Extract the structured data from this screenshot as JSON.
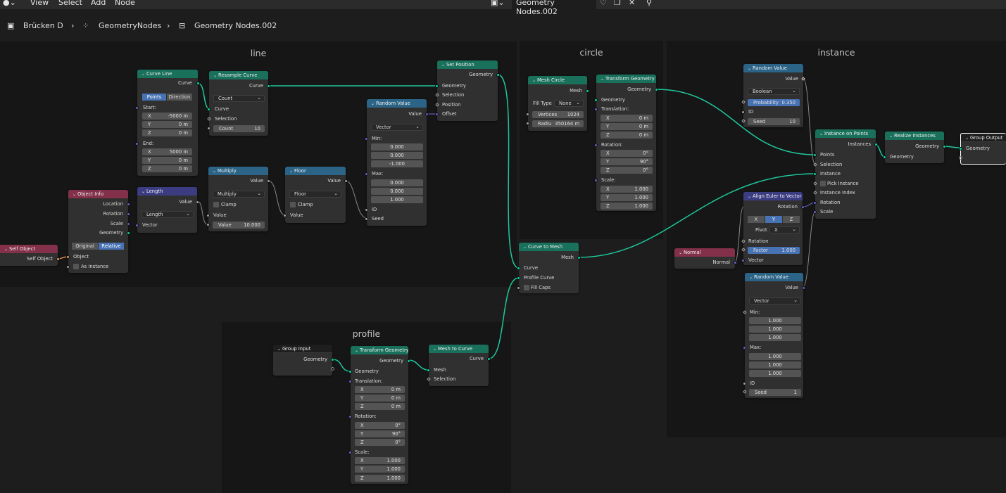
{
  "menu": {
    "view": "View",
    "select": "Select",
    "add": "Add",
    "node": "Node",
    "tree_name": "Geometry Nodes.002"
  },
  "breadcrumb": {
    "object": "Brücken D",
    "modifier": "GeometryNodes",
    "tree": "Geometry Nodes.002"
  },
  "frames": {
    "line": "line",
    "circle": "circle",
    "instance": "instance",
    "profile": "profile"
  },
  "curve_line": {
    "title": "Curve Line",
    "out_curve": "Curve",
    "mode_points": "Points",
    "mode_direction": "Direction",
    "start": "Start:",
    "end": "End:",
    "sx": "-5000 m",
    "sy": "0 m",
    "sz": "0 m",
    "ex": "5000 m",
    "ey": "0 m",
    "ez": "0 m",
    "x": "X",
    "y": "Y",
    "z": "Z"
  },
  "resample": {
    "title": "Resample Curve",
    "out_curve": "Curve",
    "mode": "Count",
    "in_curve": "Curve",
    "selection": "Selection",
    "count_label": "Count",
    "count": "10"
  },
  "set_position": {
    "title": "Set Position",
    "out_geometry": "Geometry",
    "geometry": "Geometry",
    "selection": "Selection",
    "position": "Position",
    "offset": "Offset"
  },
  "random_vec": {
    "title": "Random Value",
    "out_value": "Value",
    "type": "Vector",
    "min": "Min:",
    "max": "Max:",
    "min_vals": [
      "0.000",
      "0.000",
      "-1.000"
    ],
    "max_vals": [
      "0.000",
      "0.000",
      "1.000"
    ],
    "id": "ID",
    "seed": "Seed"
  },
  "multiply": {
    "title": "Multiply",
    "out_value": "Value",
    "op": "Multiply",
    "clamp": "Clamp",
    "value": "Value",
    "value_label": "Value",
    "value_num": "10.000"
  },
  "floor": {
    "title": "Floor",
    "out_value": "Value",
    "op": "Floor",
    "clamp": "Clamp",
    "value": "Value"
  },
  "length": {
    "title": "Length",
    "out_value": "Value",
    "op": "Length",
    "vector": "Vector"
  },
  "object_info": {
    "title": "Object Info",
    "location": "Location",
    "rotation": "Rotation",
    "scale": "Scale",
    "geometry": "Geometry",
    "original": "Original",
    "relative": "Relative",
    "object": "Object",
    "as_instance": "As Instance"
  },
  "self_object": {
    "title": "Self Object",
    "out": "Self Object"
  },
  "mesh_circle": {
    "title": "Mesh Circle",
    "out_mesh": "Mesh",
    "fill_type": "Fill Type",
    "fill_value": "None",
    "vertices_label": "Vertices",
    "vertices": "1024",
    "radius_label": "Radiu",
    "radius": "350164 m"
  },
  "transform_circle": {
    "title": "Transform Geometry",
    "out_geometry": "Geometry",
    "geometry": "Geometry",
    "translation": "Translation:",
    "rotation": "Rotation:",
    "scale": "Scale:",
    "t": [
      "0 m",
      "0 m",
      "0 m"
    ],
    "r": [
      "0°",
      "90°",
      "0°"
    ],
    "s": [
      "1.000",
      "1.000",
      "1.000"
    ]
  },
  "curve_to_mesh": {
    "title": "Curve to Mesh",
    "out_mesh": "Mesh",
    "curve": "Curve",
    "profile": "Profile Curve",
    "fill_caps": "Fill Caps"
  },
  "group_input": {
    "title": "Group Input",
    "geometry": "Geometry"
  },
  "transform_profile": {
    "title": "Transform Geometry",
    "out_geometry": "Geometry",
    "geometry": "Geometry",
    "translation": "Translation:",
    "rotation": "Rotation:",
    "scale": "Scale:",
    "t": [
      "0 m",
      "0 m",
      "0 m"
    ],
    "r": [
      "0°",
      "90°",
      "0°"
    ],
    "s": [
      "1.000",
      "1.000",
      "1.000"
    ]
  },
  "mesh_to_curve": {
    "title": "Mesh to Curve",
    "out_curve": "Curve",
    "mesh": "Mesh",
    "selection": "Selection"
  },
  "random_bool": {
    "title": "Random Value",
    "out_value": "Value",
    "type": "Boolean",
    "prob_label": "Probability",
    "prob": "0.350",
    "id": "ID",
    "seed_label": "Seed",
    "seed": "10"
  },
  "instance_on_points": {
    "title": "Instance on Points",
    "out_instances": "Instances",
    "points": "Points",
    "selection": "Selection",
    "instance": "Instance",
    "pick": "Pick Instance",
    "index": "Instance Index",
    "rotation": "Rotation",
    "scale": "Scale"
  },
  "realize": {
    "title": "Realize Instances",
    "out_geometry": "Geometry",
    "geometry": "Geometry"
  },
  "group_output": {
    "title": "Group Output",
    "geometry": "Geometry"
  },
  "align_euler": {
    "title": "Align Euler to Vector",
    "out_rotation": "Rotation",
    "x": "X",
    "y": "Y",
    "z": "Z",
    "pivot_label": "Pivot",
    "pivot": "X",
    "rotation": "Rotation",
    "factor_label": "Factor",
    "factor": "1.000",
    "vector": "Vector"
  },
  "normal": {
    "title": "Normal",
    "out": "Normal"
  },
  "random_vec2": {
    "title": "Random Value",
    "out_value": "Value",
    "type": "Vector",
    "min": "Min:",
    "max": "Max:",
    "min_vals": [
      "1.000",
      "1.000",
      "1.000"
    ],
    "max_vals": [
      "1.000",
      "1.000",
      "1.000"
    ],
    "id": "ID",
    "seed_label": "Seed",
    "seed": "1"
  }
}
